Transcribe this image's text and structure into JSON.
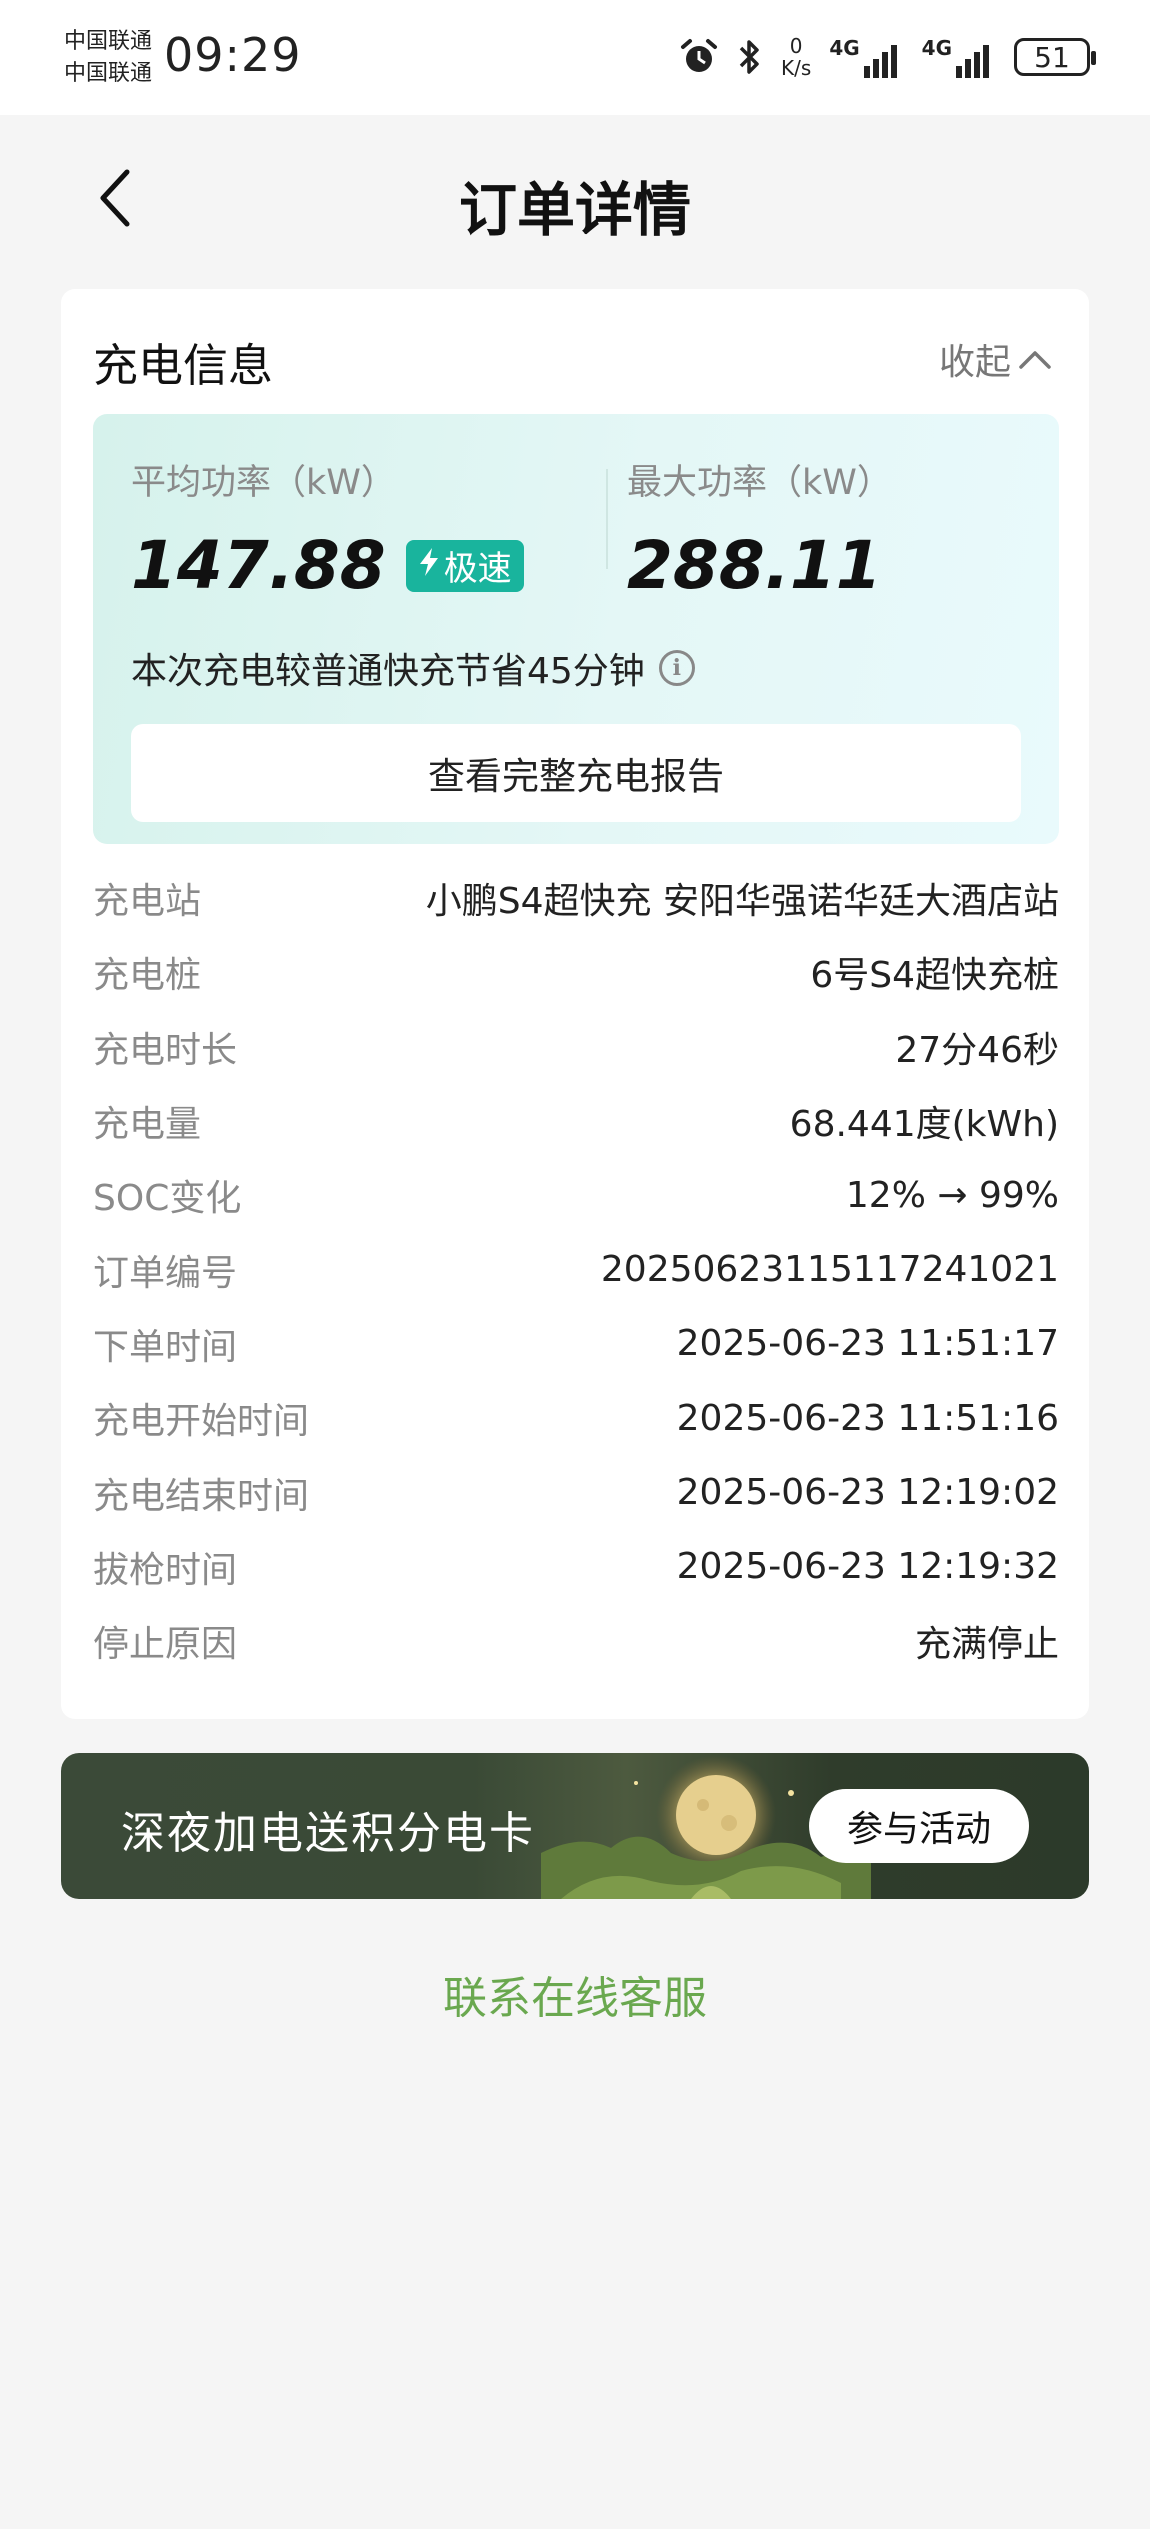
{
  "status_bar": {
    "carrier_1": "中国联通",
    "carrier_2": "中国联通",
    "time": "09:29",
    "speed_value": "0",
    "speed_unit": "K/s",
    "network_1": "4G",
    "network_2": "4G",
    "battery": "51"
  },
  "header": {
    "title": "订单详情"
  },
  "charging_info": {
    "title": "充电信息",
    "collapse_label": "收起",
    "avg_power_label": "平均功率（kW）",
    "avg_power_value": "147.88",
    "fast_badge": "极速",
    "max_power_label": "最大功率（kW）",
    "max_power_value": "288.11",
    "save_note": "本次充电较普通快充节省45分钟",
    "report_button": "查看完整充电报告",
    "details": [
      {
        "label": "充电站",
        "value": "小鹏S4超快充 安阳华强诺华廷大酒店站"
      },
      {
        "label": "充电桩",
        "value": "6号S4超快充桩"
      },
      {
        "label": "充电时长",
        "value": "27分46秒"
      },
      {
        "label": "充电量",
        "value": "68.441度(kWh)"
      },
      {
        "label": "SOC变化",
        "value": "12% → 99%"
      },
      {
        "label": "订单编号",
        "value": "2025062311511724​1021"
      },
      {
        "label": "下单时间",
        "value": "2025-06-23 11:51:17"
      },
      {
        "label": "充电开始时间",
        "value": "2025-06-23 11:51:16"
      },
      {
        "label": "充电结束时间",
        "value": "2025-06-23 12:19:02"
      },
      {
        "label": "拔枪时间",
        "value": "2025-06-23 12:19:32"
      },
      {
        "label": "停止原因",
        "value": "充满停止"
      }
    ]
  },
  "banner": {
    "text": "深夜加电送积分电卡",
    "button": "参与活动"
  },
  "service_link": "联系在线客服",
  "colors": {
    "accent_green": "#6aa84f",
    "badge_teal": "#19b49d"
  }
}
